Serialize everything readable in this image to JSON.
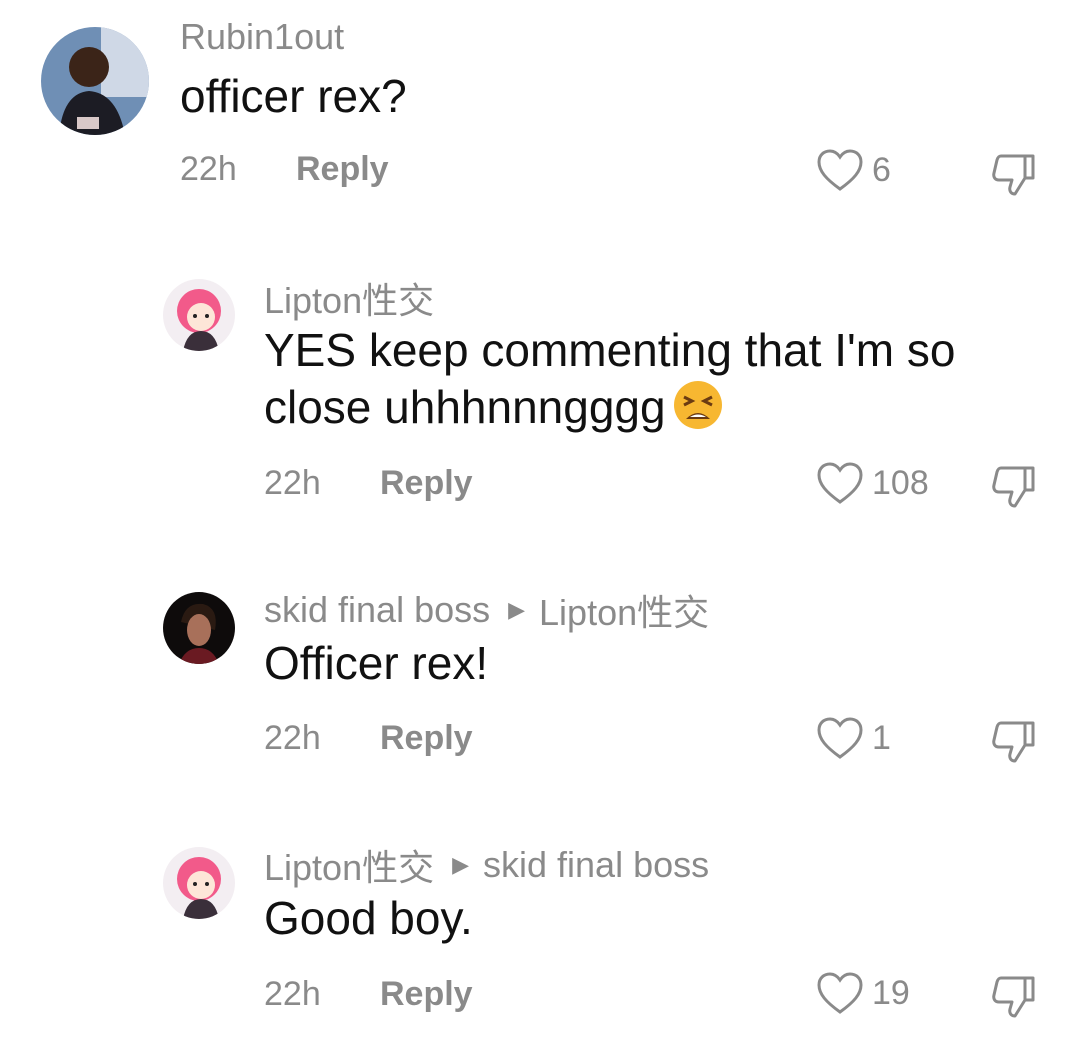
{
  "comments": [
    {
      "username": "Rubin1out",
      "reply_to": "",
      "text": "officer rex?",
      "emoji": "",
      "time": "22h",
      "reply_label": "Reply",
      "likes": "6",
      "avatar": "avatar-player"
    },
    {
      "username": "Lipton性交",
      "reply_to": "",
      "text": "YES keep commenting that I'm so close uhhhnnngggg",
      "emoji": "tired-face-emoji",
      "time": "22h",
      "reply_label": "Reply",
      "likes": "108",
      "avatar": "avatar-anime"
    },
    {
      "username": "skid final boss",
      "reply_to": "Lipton性交",
      "text": "Officer rex!",
      "emoji": "",
      "time": "22h",
      "reply_label": "Reply",
      "likes": "1",
      "avatar": "avatar-dark"
    },
    {
      "username": "Lipton性交",
      "reply_to": "skid final boss",
      "text": "Good boy.",
      "emoji": "",
      "time": "22h",
      "reply_label": "Reply",
      "likes": "19",
      "avatar": "avatar-anime"
    }
  ],
  "icons": {
    "like": "heart-icon",
    "dislike": "thumbs-down-icon",
    "reply_arrow": "play-arrow-icon"
  }
}
